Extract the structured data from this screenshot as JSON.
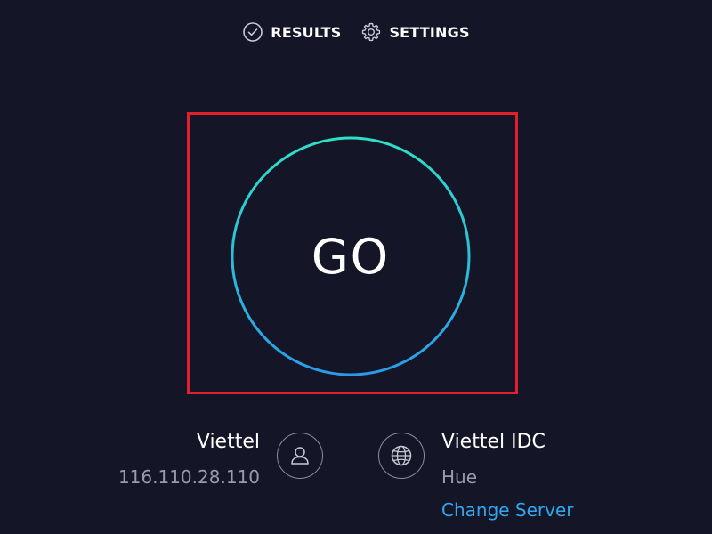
{
  "nav": {
    "results_label": "RESULTS",
    "settings_label": "SETTINGS"
  },
  "go": {
    "label": "GO"
  },
  "provider": {
    "name": "Viettel",
    "ip": "116.110.28.110"
  },
  "server": {
    "name": "Viettel IDC",
    "location": "Hue",
    "change_label": "Change Server"
  },
  "colors": {
    "background": "#141526",
    "ring_start": "#2fe0c8",
    "ring_end": "#2b9be8",
    "highlight": "#e2202c",
    "link": "#2fa8ee",
    "muted_text": "#9a9aae"
  },
  "icons": {
    "results": "check-circle-icon",
    "settings": "gear-icon",
    "provider": "user-icon",
    "server": "globe-icon"
  }
}
